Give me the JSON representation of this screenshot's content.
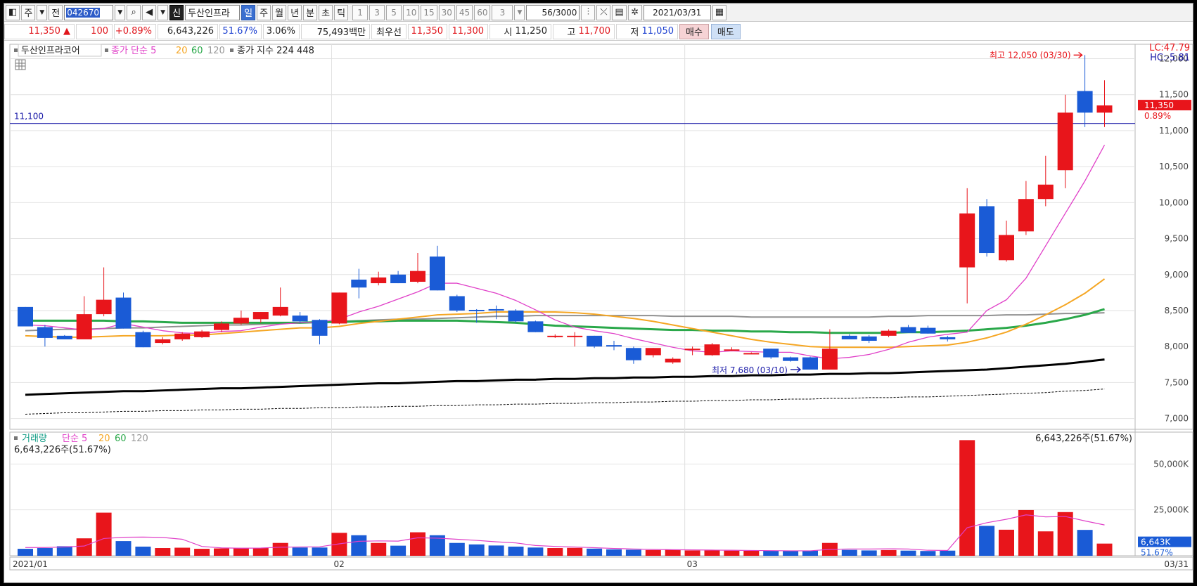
{
  "toolbar": {
    "market_label": "주",
    "all_label": "전",
    "stock_code": "042670",
    "new_badge": "신",
    "stock_name": "두산인프라",
    "period_tabs": [
      "일",
      "주",
      "월",
      "년",
      "분",
      "초",
      "틱"
    ],
    "active_tab": "일",
    "interval_buttons": [
      "1",
      "3",
      "5",
      "10",
      "15",
      "30",
      "45",
      "60"
    ],
    "unit_value": "3",
    "count_value": "56",
    "count_total": "/3000",
    "date_value": "2021/03/31"
  },
  "quote": {
    "price": "11,350",
    "change_arrow": "▲",
    "change": "100",
    "change_pct": "+0.89%",
    "volume": "6,643,226",
    "turnover_pct": "51.67%",
    "pct2": "3.06%",
    "amount": "75,493백만",
    "best_label": "최우선",
    "best_ask": "11,350",
    "best_bid": "11,300",
    "open_label": "시",
    "open": "11,250",
    "high_label": "고",
    "high": "11,700",
    "low_label": "저",
    "low": "11,050",
    "buy_label": "매수",
    "sell_label": "매도"
  },
  "legend": {
    "name": "두산인프라코어",
    "ma_label": "종가 단순",
    "ma_periods": [
      "5",
      "20",
      "60",
      "120"
    ],
    "index_label": "종가 지수",
    "index_periods": [
      "224",
      "448"
    ],
    "lc_text": "LC:47.79",
    "hc_text": "HC:-5.81",
    "hline_label": "11,100",
    "high_marker": "최고 12,050 (03/30)",
    "low_marker": "최저 7,680 (03/10)",
    "last_price_tag": "11,350",
    "last_pct_tag": "0.89%"
  },
  "volume_legend": {
    "title": "거래량",
    "ma_label": "단순",
    "ma_periods": [
      "5",
      "20",
      "60",
      "120"
    ],
    "summary": "6,643,226주(51.67%)",
    "right_summary": "6,643,226주(51.67%)",
    "last_tag": "6,643K",
    "last_pct_tag": "51.67%"
  },
  "xaxis": {
    "labels": [
      "2021/01",
      "02",
      "03"
    ],
    "right_label": "03/31"
  },
  "colors": {
    "up": "#e8151b",
    "down": "#1a5bd6",
    "ma5": "#e040c8",
    "ma20": "#f5a623",
    "ma60": "#2aa84a",
    "ma120": "#909090",
    "idx224": "#000000",
    "hline": "#1a1aa8"
  },
  "chart_data": {
    "type": "candlestick",
    "price_ticks": [
      7000,
      7500,
      8000,
      8500,
      9000,
      9500,
      10000,
      10500,
      11000,
      11500,
      12000
    ],
    "price_tick_labels": [
      "7,000",
      "7,500",
      "8,000",
      "8,500",
      "9,000",
      "9,500",
      "10,000",
      "10,500",
      "11,000",
      "11,500",
      "12,000"
    ],
    "ylim": [
      6850,
      12200
    ],
    "hline": 11100,
    "candles": [
      {
        "o": 8550,
        "h": 8550,
        "l": 8280,
        "c": 8280
      },
      {
        "o": 8270,
        "h": 8300,
        "l": 8000,
        "c": 8120
      },
      {
        "o": 8150,
        "h": 8160,
        "l": 8100,
        "c": 8100
      },
      {
        "o": 8100,
        "h": 8700,
        "l": 8100,
        "c": 8450
      },
      {
        "o": 8450,
        "h": 9100,
        "l": 8420,
        "c": 8650
      },
      {
        "o": 8680,
        "h": 8750,
        "l": 8250,
        "c": 8250
      },
      {
        "o": 8200,
        "h": 8220,
        "l": 7990,
        "c": 7990
      },
      {
        "o": 8050,
        "h": 8130,
        "l": 8030,
        "c": 8100
      },
      {
        "o": 8100,
        "h": 8200,
        "l": 8080,
        "c": 8180
      },
      {
        "o": 8130,
        "h": 8230,
        "l": 8120,
        "c": 8210
      },
      {
        "o": 8230,
        "h": 8350,
        "l": 8200,
        "c": 8320
      },
      {
        "o": 8320,
        "h": 8500,
        "l": 8300,
        "c": 8400
      },
      {
        "o": 8380,
        "h": 8480,
        "l": 8330,
        "c": 8480
      },
      {
        "o": 8430,
        "h": 8820,
        "l": 8420,
        "c": 8550
      },
      {
        "o": 8430,
        "h": 8480,
        "l": 8330,
        "c": 8350
      },
      {
        "o": 8370,
        "h": 8380,
        "l": 8030,
        "c": 8150
      },
      {
        "o": 8320,
        "h": 8750,
        "l": 8310,
        "c": 8750
      },
      {
        "o": 8930,
        "h": 9080,
        "l": 8670,
        "c": 8820
      },
      {
        "o": 8880,
        "h": 9040,
        "l": 8850,
        "c": 8960
      },
      {
        "o": 9000,
        "h": 9050,
        "l": 8880,
        "c": 8880
      },
      {
        "o": 8900,
        "h": 9300,
        "l": 8880,
        "c": 9050
      },
      {
        "o": 9250,
        "h": 9400,
        "l": 8780,
        "c": 8780
      },
      {
        "o": 8700,
        "h": 8720,
        "l": 8480,
        "c": 8500
      },
      {
        "o": 8510,
        "h": 8520,
        "l": 8330,
        "c": 8500
      },
      {
        "o": 8520,
        "h": 8570,
        "l": 8380,
        "c": 8500
      },
      {
        "o": 8500,
        "h": 8520,
        "l": 8330,
        "c": 8350
      },
      {
        "o": 8350,
        "h": 8360,
        "l": 8200,
        "c": 8200
      },
      {
        "o": 8150,
        "h": 8170,
        "l": 8120,
        "c": 8150
      },
      {
        "o": 8150,
        "h": 8200,
        "l": 8000,
        "c": 8150
      },
      {
        "o": 8150,
        "h": 8150,
        "l": 7980,
        "c": 8000
      },
      {
        "o": 8020,
        "h": 8080,
        "l": 7950,
        "c": 8000
      },
      {
        "o": 7980,
        "h": 8000,
        "l": 7760,
        "c": 7810
      },
      {
        "o": 7880,
        "h": 7980,
        "l": 7850,
        "c": 7980
      },
      {
        "o": 7780,
        "h": 7850,
        "l": 7760,
        "c": 7830
      },
      {
        "o": 7950,
        "h": 8000,
        "l": 7880,
        "c": 7970
      },
      {
        "o": 7880,
        "h": 8050,
        "l": 7870,
        "c": 8030
      },
      {
        "o": 7950,
        "h": 7990,
        "l": 7940,
        "c": 7960
      },
      {
        "o": 7900,
        "h": 7920,
        "l": 7900,
        "c": 7910
      },
      {
        "o": 7970,
        "h": 7970,
        "l": 7830,
        "c": 7850
      },
      {
        "o": 7850,
        "h": 7860,
        "l": 7790,
        "c": 7800
      },
      {
        "o": 7850,
        "h": 7860,
        "l": 7680,
        "c": 7680
      },
      {
        "o": 7680,
        "h": 8240,
        "l": 7680,
        "c": 7970
      },
      {
        "o": 8150,
        "h": 8170,
        "l": 8100,
        "c": 8100
      },
      {
        "o": 8140,
        "h": 8160,
        "l": 8050,
        "c": 8080
      },
      {
        "o": 8150,
        "h": 8240,
        "l": 8130,
        "c": 8220
      },
      {
        "o": 8270,
        "h": 8300,
        "l": 8190,
        "c": 8190
      },
      {
        "o": 8260,
        "h": 8290,
        "l": 8180,
        "c": 8180
      },
      {
        "o": 8130,
        "h": 8150,
        "l": 8070,
        "c": 8100
      },
      {
        "o": 9100,
        "h": 10200,
        "l": 8600,
        "c": 9850
      },
      {
        "o": 9950,
        "h": 10050,
        "l": 9250,
        "c": 9300
      },
      {
        "o": 9200,
        "h": 9750,
        "l": 9180,
        "c": 9550
      },
      {
        "o": 9600,
        "h": 10300,
        "l": 9550,
        "c": 10050
      },
      {
        "o": 10050,
        "h": 10650,
        "l": 9950,
        "c": 10250
      },
      {
        "o": 10450,
        "h": 11500,
        "l": 10200,
        "c": 11250
      },
      {
        "o": 11550,
        "h": 12050,
        "l": 11050,
        "c": 11250
      },
      {
        "o": 11250,
        "h": 11700,
        "l": 11050,
        "c": 11350
      }
    ],
    "ma5": [
      8300,
      8290,
      8260,
      8230,
      8250,
      8320,
      8270,
      8220,
      8190,
      8180,
      8210,
      8220,
      8270,
      8310,
      8330,
      8340,
      8380,
      8480,
      8560,
      8660,
      8760,
      8880,
      8880,
      8810,
      8740,
      8640,
      8510,
      8370,
      8270,
      8220,
      8180,
      8110,
      8050,
      7990,
      7940,
      7920,
      7940,
      7930,
      7920,
      7920,
      7870,
      7830,
      7850,
      7890,
      7960,
      8060,
      8130,
      8170,
      8200,
      8500,
      8650,
      8950,
      9400,
      9850,
      10300,
      10800
    ],
    "ma20": [
      8150,
      8140,
      8130,
      8130,
      8140,
      8150,
      8150,
      8150,
      8160,
      8160,
      8180,
      8200,
      8220,
      8240,
      8260,
      8260,
      8280,
      8320,
      8350,
      8380,
      8410,
      8440,
      8450,
      8460,
      8480,
      8480,
      8480,
      8480,
      8470,
      8450,
      8420,
      8390,
      8350,
      8300,
      8250,
      8200,
      8150,
      8100,
      8060,
      8030,
      8000,
      7990,
      7990,
      7990,
      7990,
      8000,
      8010,
      8020,
      8060,
      8120,
      8200,
      8310,
      8440,
      8580,
      8740,
      8940
    ],
    "ma60": [
      8360,
      8360,
      8360,
      8360,
      8360,
      8350,
      8350,
      8340,
      8330,
      8330,
      8330,
      8330,
      8330,
      8330,
      8330,
      8340,
      8340,
      8350,
      8350,
      8360,
      8360,
      8360,
      8360,
      8350,
      8340,
      8330,
      8310,
      8290,
      8280,
      8270,
      8260,
      8250,
      8240,
      8230,
      8230,
      8220,
      8220,
      8210,
      8210,
      8200,
      8200,
      8190,
      8190,
      8190,
      8190,
      8200,
      8200,
      8210,
      8220,
      8240,
      8260,
      8290,
      8330,
      8380,
      8440,
      8520
    ],
    "ma120": [
      8220,
      8230,
      8240,
      8240,
      8250,
      8260,
      8260,
      8270,
      8280,
      8290,
      8300,
      8300,
      8310,
      8320,
      8330,
      8340,
      8350,
      8360,
      8370,
      8380,
      8380,
      8390,
      8400,
      8410,
      8420,
      8420,
      8430,
      8430,
      8430,
      8430,
      8430,
      8430,
      8430,
      8420,
      8420,
      8420,
      8420,
      8410,
      8410,
      8410,
      8410,
      8410,
      8410,
      8410,
      8420,
      8420,
      8430,
      8430,
      8430,
      8430,
      8440,
      8440,
      8450,
      8460,
      8460,
      8470
    ],
    "idx224": [
      7330,
      7340,
      7350,
      7360,
      7370,
      7380,
      7380,
      7390,
      7400,
      7410,
      7420,
      7420,
      7430,
      7440,
      7450,
      7460,
      7470,
      7480,
      7490,
      7490,
      7500,
      7510,
      7520,
      7520,
      7530,
      7540,
      7540,
      7550,
      7550,
      7560,
      7560,
      7570,
      7570,
      7580,
      7580,
      7590,
      7590,
      7600,
      7600,
      7610,
      7610,
      7620,
      7620,
      7630,
      7630,
      7640,
      7650,
      7660,
      7670,
      7680,
      7700,
      7720,
      7740,
      7760,
      7790,
      7820
    ],
    "idx448": [
      7060,
      7070,
      7080,
      7080,
      7090,
      7100,
      7100,
      7110,
      7110,
      7120,
      7120,
      7130,
      7130,
      7140,
      7140,
      7150,
      7150,
      7160,
      7160,
      7170,
      7170,
      7180,
      7180,
      7190,
      7190,
      7200,
      7200,
      7210,
      7210,
      7220,
      7220,
      7230,
      7230,
      7240,
      7240,
      7250,
      7250,
      7260,
      7260,
      7270,
      7270,
      7280,
      7280,
      7290,
      7290,
      7300,
      7300,
      7310,
      7320,
      7330,
      7340,
      7350,
      7360,
      7380,
      7390,
      7410
    ],
    "volume_ticks": [
      25000,
      50000
    ],
    "volume_tick_labels": [
      "25,000K",
      "50,000K"
    ],
    "volume_ylim": [
      0,
      62000
    ],
    "volume": [
      3800,
      4200,
      5200,
      9500,
      23500,
      8000,
      5000,
      4200,
      4400,
      3800,
      4000,
      4300,
      4200,
      7000,
      4500,
      4500,
      12500,
      11200,
      7000,
      5500,
      12800,
      11200,
      7000,
      6200,
      5600,
      5000,
      4500,
      4200,
      4300,
      3900,
      3500,
      3300,
      3100,
      3300,
      2900,
      2900,
      2800,
      2700,
      2800,
      2700,
      2800,
      7000,
      3200,
      2900,
      3100,
      2800,
      2600,
      2800,
      63000,
      16300,
      14200,
      24900,
      13300,
      23800,
      14100,
      6643
    ],
    "volume_ma5": [
      4500,
      4500,
      4800,
      5300,
      9400,
      10100,
      10200,
      10000,
      9000,
      5100,
      4300,
      4100,
      4200,
      4700,
      4800,
      4900,
      6500,
      7900,
      8100,
      8000,
      9800,
      9600,
      9000,
      8400,
      7600,
      7000,
      5600,
      5100,
      4800,
      4400,
      4000,
      3700,
      3500,
      3300,
      3200,
      3100,
      3000,
      2900,
      2800,
      2700,
      2700,
      3500,
      3700,
      3700,
      3800,
      3700,
      3000,
      2900,
      15300,
      18000,
      19900,
      22300,
      21200,
      21400,
      19000,
      16800
    ]
  }
}
